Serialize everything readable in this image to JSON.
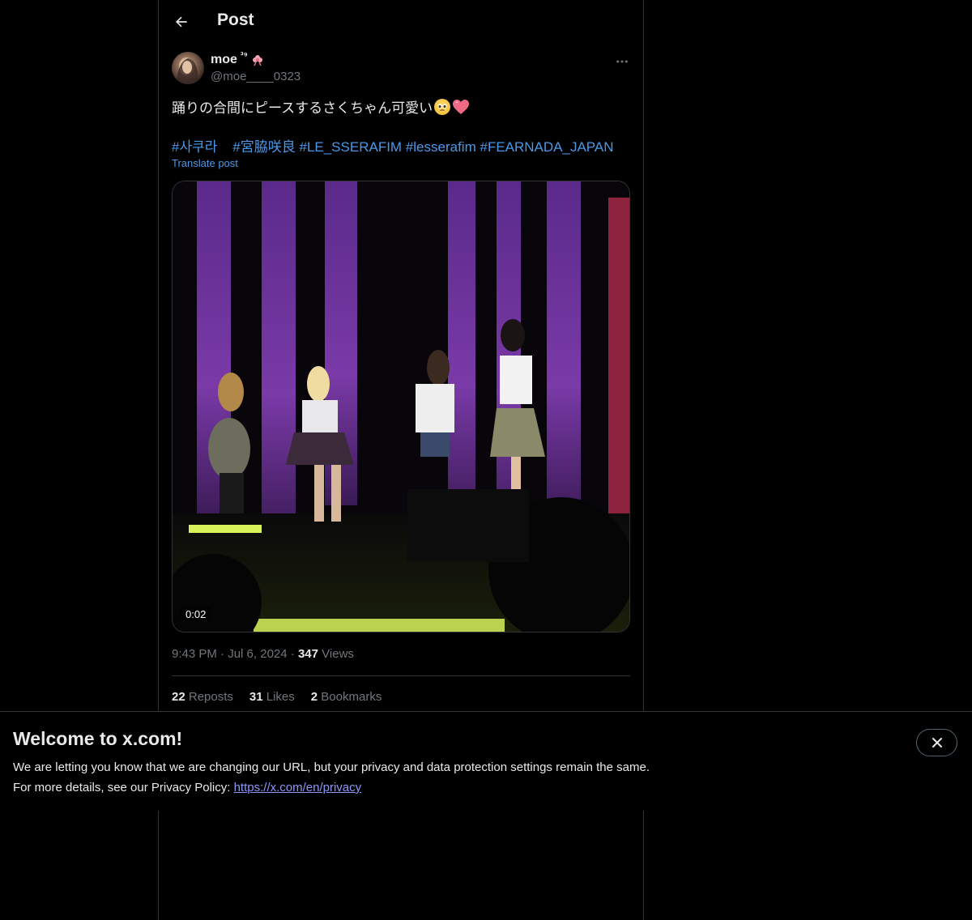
{
  "header": {
    "title": "Post"
  },
  "author": {
    "display_name": "moe",
    "name_badge": "³⁹",
    "handle": "@moe____0323"
  },
  "post": {
    "text": "踊りの合間にピースするさくちゃん可愛い",
    "hashtags": [
      "#사쿠라",
      "#宮脇咲良",
      "#LE_SSERAFIM",
      "#lesserafim",
      "#FEARNADA_JAPAN"
    ],
    "translate_label": "Translate post",
    "video_duration": "0:02",
    "time": "9:43 PM",
    "date": "Jul 6, 2024",
    "views_count": "347",
    "views_label": "Views"
  },
  "stats": [
    {
      "count": "22",
      "label": "Reposts"
    },
    {
      "count": "31",
      "label": "Likes"
    },
    {
      "count": "2",
      "label": "Bookmarks"
    }
  ],
  "banner": {
    "title": "Welcome to x.com!",
    "line1": "We are letting you know that we are changing our URL, but your privacy and data protection settings remain the same.",
    "line2_prefix": "For more details, see our Privacy Policy: ",
    "link": "https://x.com/en/privacy"
  },
  "icons": {
    "back": "arrow-left-icon",
    "more": "more-horizontal-icon",
    "close": "close-icon"
  },
  "colors": {
    "background": "#000000",
    "text": "#e7e9ea",
    "muted": "#71767b",
    "link": "#4a99e9",
    "border": "#2f3336"
  }
}
